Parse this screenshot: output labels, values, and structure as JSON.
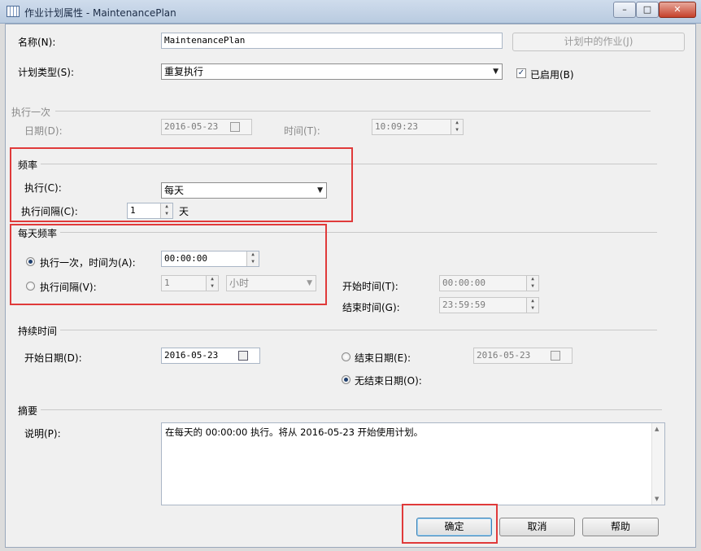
{
  "window": {
    "title": "作业计划属性 - MaintenancePlan",
    "min": "–",
    "max": "□",
    "close": "✕"
  },
  "name": {
    "label": "名称(N):",
    "value": "MaintenancePlan"
  },
  "jobs_button": "计划中的作业(J)",
  "schedule_type": {
    "label": "计划类型(S):",
    "value": "重复执行",
    "enabled_label": "已启用(B)",
    "enabled": true
  },
  "once": {
    "title": "执行一次",
    "date_label": "日期(D):",
    "date": "2016-05-23",
    "time_label": "时间(T):",
    "time": "10:09:23"
  },
  "frequency": {
    "title": "频率",
    "occurs_label": "执行(C):",
    "occurs": "每天",
    "recurs_label": "执行间隔(C):",
    "recurs": "1",
    "unit": "天"
  },
  "daily": {
    "title": "每天频率",
    "once_label": "执行一次，时间为(A):",
    "once_time": "00:00:00",
    "every_label": "执行间隔(V):",
    "every_value": "1",
    "every_unit": "小时",
    "start_label": "开始时间(T):",
    "start_time": "00:00:00",
    "end_label": "结束时间(G):",
    "end_time": "23:59:59",
    "mode": "once"
  },
  "duration": {
    "title": "持续时间",
    "start_label": "开始日期(D):",
    "start_date": "2016-05-23",
    "end_label": "结束日期(E):",
    "end_date": "2016-05-23",
    "no_end_label": "无结束日期(O):",
    "mode": "no_end"
  },
  "summary": {
    "title": "摘要",
    "desc_label": "说明(P):",
    "desc": "在每天的 00:00:00 执行。将从 2016-05-23 开始使用计划。"
  },
  "buttons": {
    "ok": "确定",
    "cancel": "取消",
    "help": "帮助"
  },
  "colors": {
    "highlight": "#e03a3a",
    "titlebar": "#c4d4e8"
  }
}
